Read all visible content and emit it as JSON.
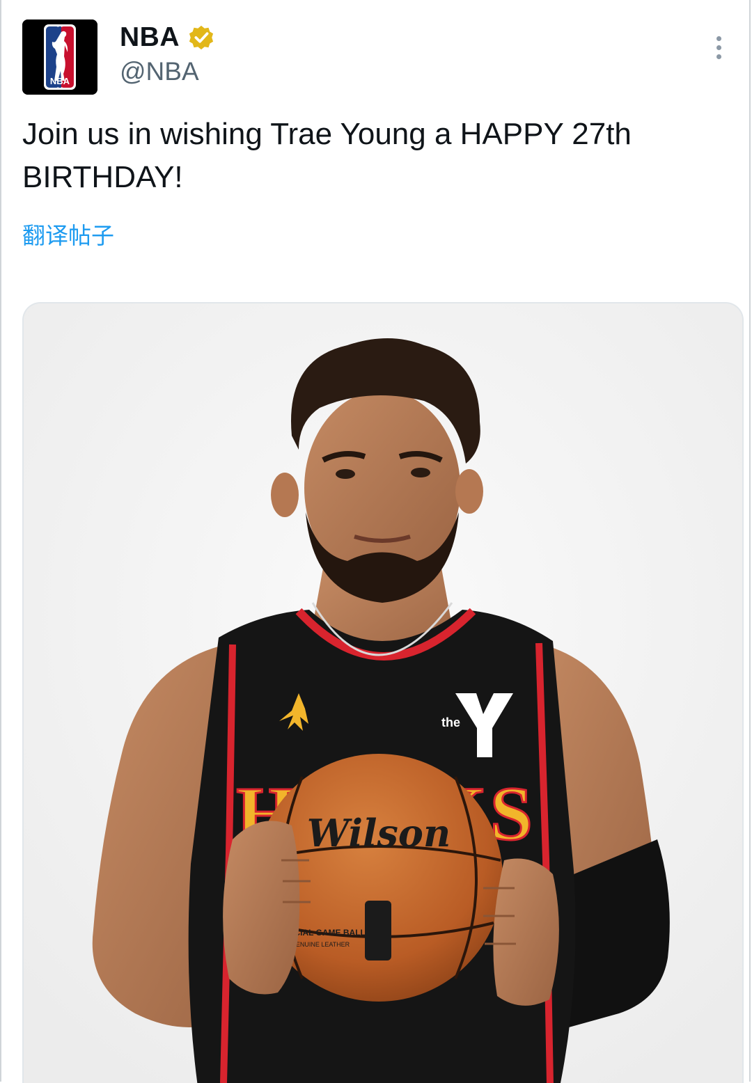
{
  "author": {
    "display_name": "NBA",
    "handle": "@NBA",
    "avatar_icon": "nba-logo-icon",
    "verified_icon": "verified-badge-icon",
    "verified_color": "#e2b719"
  },
  "tweet": {
    "text": "Join us in wishing Trae Young a HAPPY 27th BIRTHDAY!",
    "translate_label": "翻译帖子"
  },
  "media": {
    "logo_text": "NBA",
    "jersey_text": "HAWKS",
    "ball_brand": "Wilson",
    "ball_text_1": "OFFICIAL GAME BALL",
    "ball_text_2": "GENUINE LEATHER",
    "sponsor_text": "the"
  },
  "colors": {
    "link": "#1d9bf0",
    "secondary_text": "#536471",
    "jersey_red": "#d8242e",
    "jersey_yellow": "#f2b52b",
    "ball_orange": "#c4692e"
  }
}
